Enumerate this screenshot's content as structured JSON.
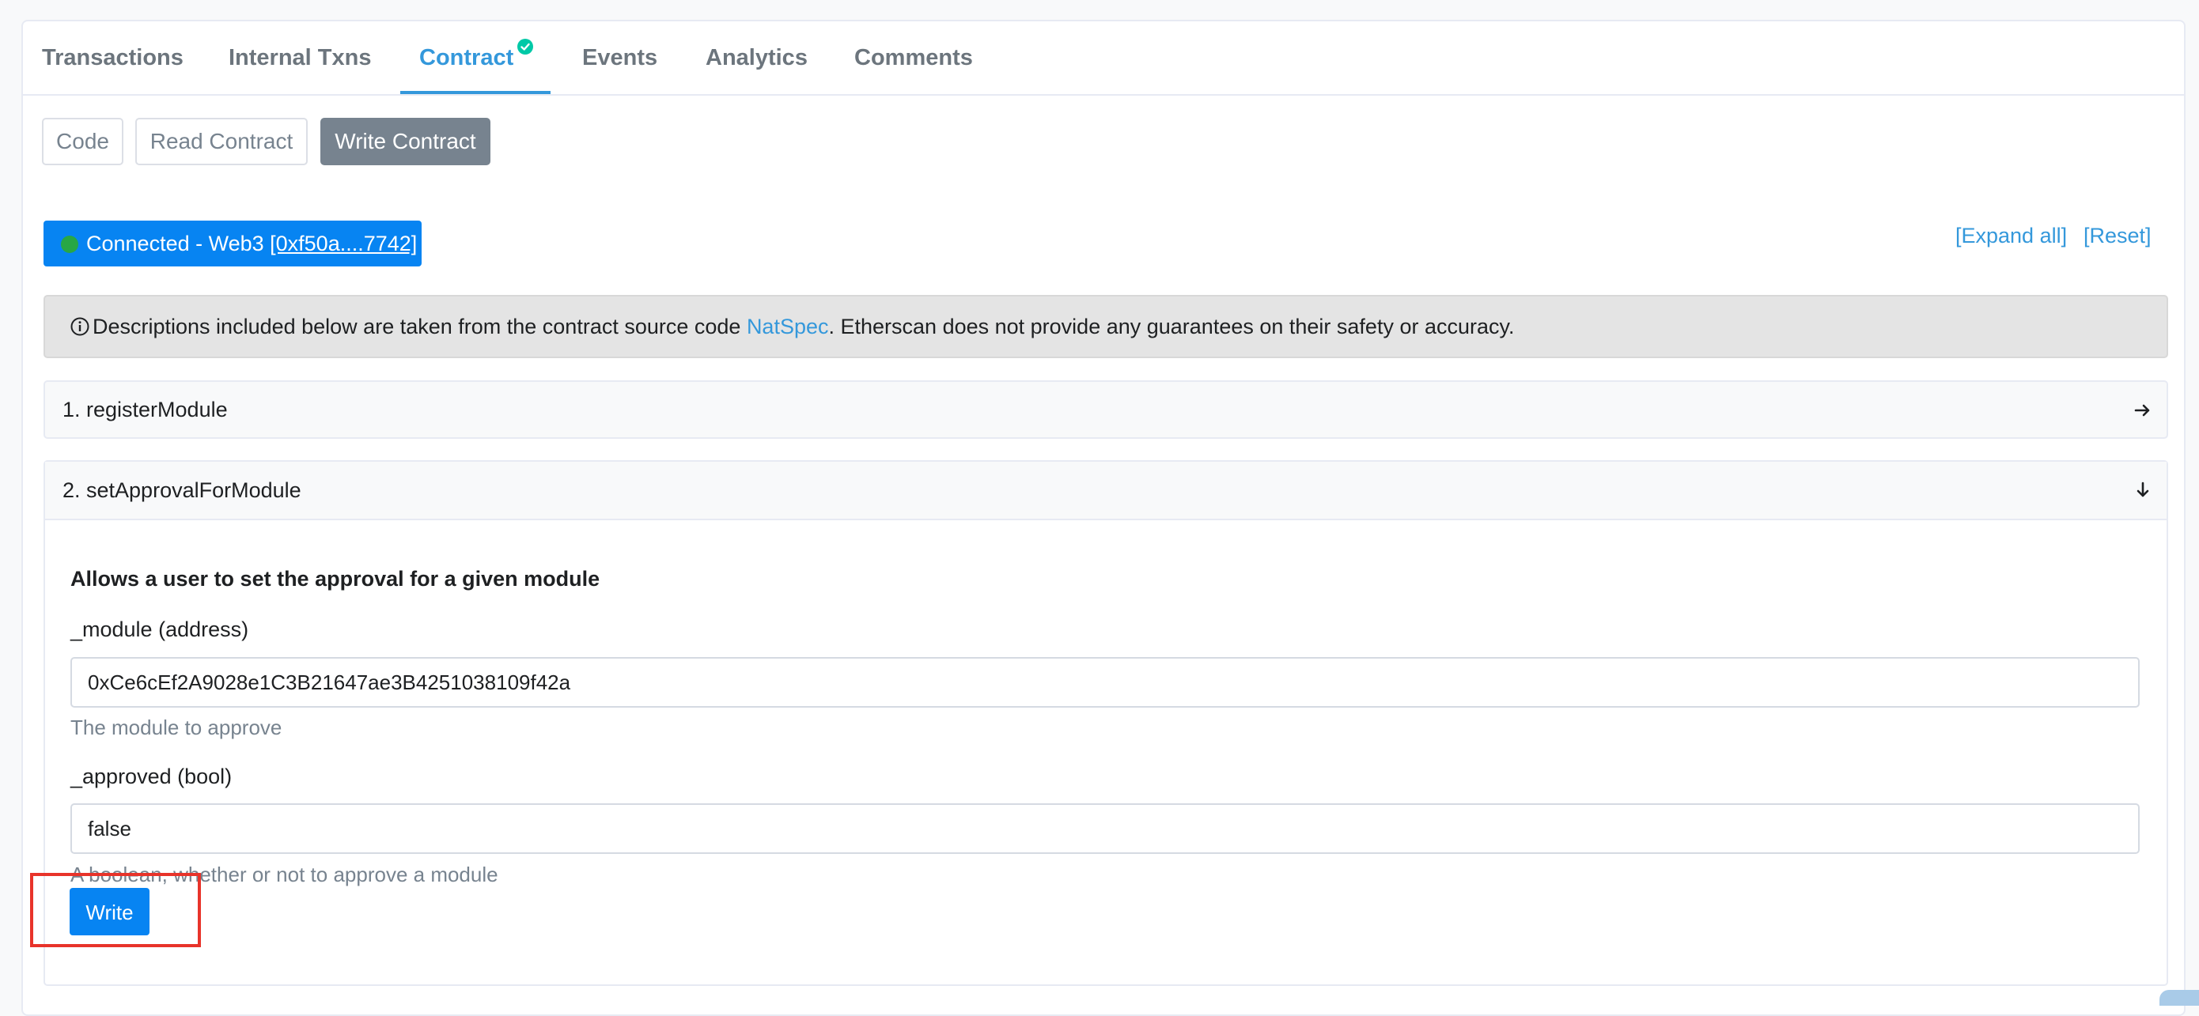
{
  "tabs": {
    "transactions": "Transactions",
    "internal": "Internal Txns",
    "contract": "Contract",
    "events": "Events",
    "analytics": "Analytics",
    "comments": "Comments",
    "active": "Contract"
  },
  "subtabs": {
    "code": "Code",
    "read": "Read Contract",
    "write": "Write Contract",
    "active": "Write Contract"
  },
  "connection": {
    "label": "Connected - Web3 ",
    "address": "[0xf50a....7742]",
    "status_color": "#28a745"
  },
  "links": {
    "expand_all": "[Expand all]",
    "reset": "[Reset]"
  },
  "alert": {
    "text_before": " Descriptions included below are taken from the contract source code ",
    "link": "NatSpec",
    "text_after": ". Etherscan does not provide any guarantees on their safety or accuracy."
  },
  "functions": [
    {
      "title": "1. registerModule",
      "expanded": false,
      "arrow_icon": "arrow-right-icon"
    },
    {
      "title": "2. setApprovalForModule",
      "expanded": true,
      "arrow_icon": "arrow-down-icon",
      "description": "Allows a user to set the approval for a given module",
      "params": [
        {
          "label": "_module (address)",
          "value": "0xCe6cEf2A9028e1C3B21647ae3B4251038109f42a",
          "help": "The module to approve"
        },
        {
          "label": "_approved (bool)",
          "value": "false",
          "help": "A boolean, whether or not to approve a module"
        }
      ],
      "button": "Write"
    }
  ],
  "colors": {
    "accent": "#3498db",
    "primary_button": "#0784f2",
    "highlight": "#e8332a",
    "verified": "#00c9a7"
  }
}
